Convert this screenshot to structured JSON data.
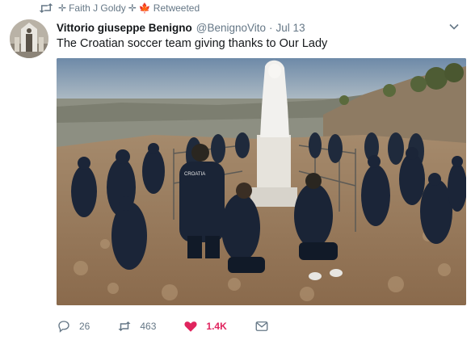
{
  "retweet": {
    "icon": "retweet-icon",
    "user_prefix": "✛",
    "user_name": "Faith J Goldy",
    "user_suffix": "✛",
    "flag": "🍁",
    "label": "Retweeted"
  },
  "tweet": {
    "display_name": "Vittorio giuseppe Benigno",
    "handle": "@BenignoVito",
    "separator": "·",
    "time": "Jul 13",
    "text": "The Croatian soccer team giving thanks to Our Lady",
    "jacket_text": "CROATIA"
  },
  "actions": {
    "replies": "26",
    "retweets": "463",
    "likes": "1.4K",
    "like_color": "#e0245e"
  },
  "colors": {
    "secondary": "#657786",
    "text": "#14171a"
  }
}
